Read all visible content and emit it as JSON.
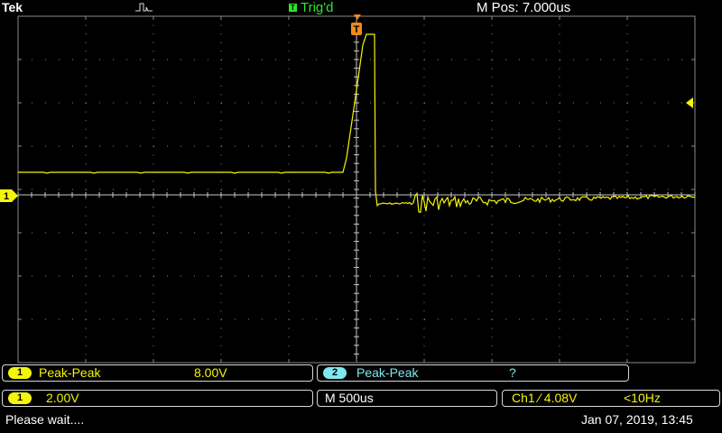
{
  "header": {
    "brand": "Tek",
    "trigger_status": "Trig'd",
    "trigger_icon": "T",
    "m_pos": "M Pos: 7.000us"
  },
  "markers": {
    "trigger_marker": "T",
    "ch1_ground_marker": "1"
  },
  "measurements": [
    {
      "channel": "1",
      "name": "Peak-Peak",
      "value": "8.00V"
    },
    {
      "channel": "2",
      "name": "Peak-Peak",
      "value": "?"
    }
  ],
  "settings": {
    "ch1_channel": "1",
    "ch1_scale": "2.00V",
    "timebase": "M 500us",
    "trigger": "Ch1 ∕ 4.08V",
    "trigger_freq": "<10Hz"
  },
  "status": {
    "message": "Please wait....",
    "datetime": "Jan 07, 2019, 13:45"
  },
  "colors": {
    "ch1": "#f5f50a",
    "ch2": "#7fe7f0",
    "trigger": "#f08a1a",
    "grid": "#8a8a8a",
    "status_green": "#2ee62e"
  }
}
